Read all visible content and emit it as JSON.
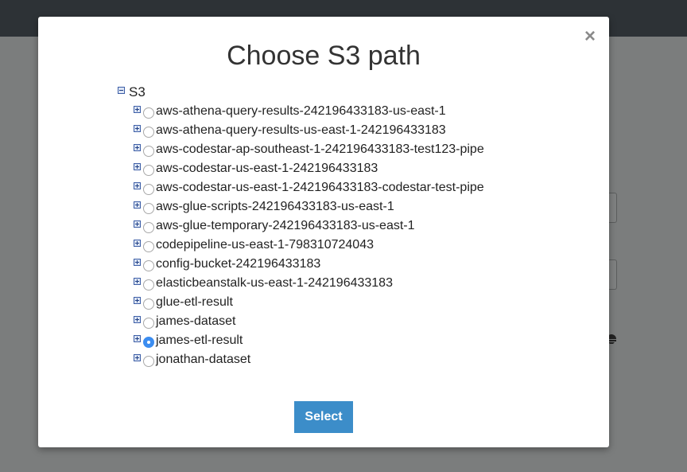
{
  "modal": {
    "title": "Choose S3 path",
    "close_glyph": "×",
    "select_label": "Select"
  },
  "tree": {
    "root_label": "S3",
    "root_expanded": true,
    "items": [
      {
        "label": "aws-athena-query-results-242196433183-us-east-1",
        "selected": false
      },
      {
        "label": "aws-athena-query-results-us-east-1-242196433183",
        "selected": false
      },
      {
        "label": "aws-codestar-ap-southeast-1-242196433183-test123-pipe",
        "selected": false
      },
      {
        "label": "aws-codestar-us-east-1-242196433183",
        "selected": false
      },
      {
        "label": "aws-codestar-us-east-1-242196433183-codestar-test-pipe",
        "selected": false
      },
      {
        "label": "aws-glue-scripts-242196433183-us-east-1",
        "selected": false
      },
      {
        "label": "aws-glue-temporary-242196433183-us-east-1",
        "selected": false
      },
      {
        "label": "codepipeline-us-east-1-798310724043",
        "selected": false
      },
      {
        "label": "config-bucket-242196433183",
        "selected": false
      },
      {
        "label": "elasticbeanstalk-us-east-1-242196433183",
        "selected": false
      },
      {
        "label": "glue-etl-result",
        "selected": false
      },
      {
        "label": "james-dataset",
        "selected": false
      },
      {
        "label": "james-etl-result",
        "selected": true
      },
      {
        "label": "jonathan-dataset",
        "selected": false
      }
    ]
  },
  "colors": {
    "overlay": "#7b7d7d",
    "topbar": "#2d3236",
    "select_button": "#3c8dc9",
    "radio_checked": "#3c8df0"
  },
  "icons": {
    "close": "close-icon",
    "collapse": "minus-square-icon",
    "expand": "plus-square-icon",
    "radio": "radio-icon"
  }
}
